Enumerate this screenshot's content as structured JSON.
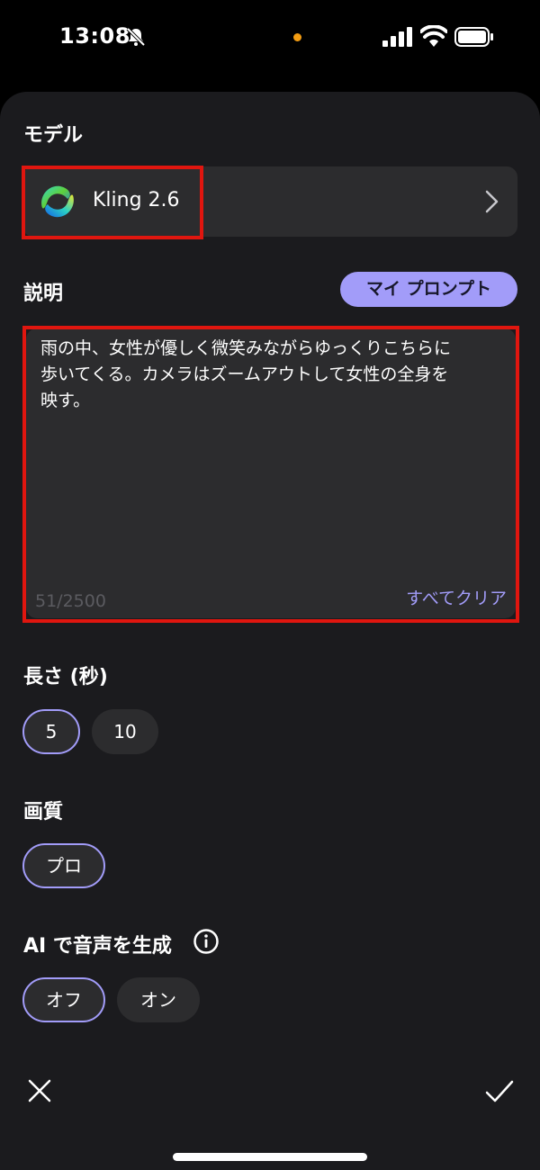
{
  "status_bar": {
    "time": "13:08"
  },
  "model": {
    "section_label": "モデル",
    "name": "Kling 2.6"
  },
  "description": {
    "section_label": "説明",
    "my_prompt_label": "マイ プロンプト",
    "text": "雨の中、女性が優しく微笑みながらゆっくりこちらに\n歩いてくる。カメラはズームアウトして女性の全身を\n映す。",
    "counter": "51/2500",
    "clear_all_label": "すべてクリア"
  },
  "duration": {
    "section_label": "長さ (秒)",
    "options": [
      "5",
      "10"
    ],
    "selected": "5"
  },
  "quality": {
    "section_label": "画質",
    "options": [
      "プロ"
    ],
    "selected": "プロ"
  },
  "ai_audio": {
    "section_label": "AI で音声を生成",
    "options": [
      "オフ",
      "オン"
    ],
    "selected": "オフ"
  },
  "colors": {
    "accent": "#a29cf9",
    "sheet_bg": "#1b1b1e",
    "field_bg": "#2c2c2e",
    "highlight": "#e0160f"
  }
}
